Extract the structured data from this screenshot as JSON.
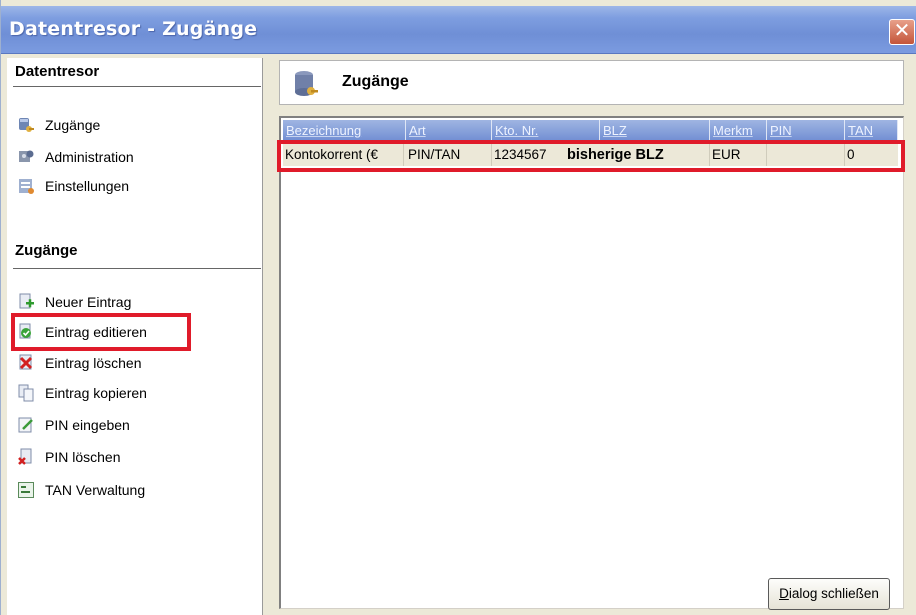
{
  "window": {
    "title": "Datentresor - Zugänge",
    "close_symbol": "✕"
  },
  "sidebar": {
    "section1_title": "Datentresor",
    "section1_items": [
      {
        "label": "Zugänge",
        "icon": "database-key-icon"
      },
      {
        "label": "Administration",
        "icon": "gear-puzzle-icon"
      },
      {
        "label": "Einstellungen",
        "icon": "settings-list-icon"
      }
    ],
    "section2_title": "Zugänge",
    "section2_items": [
      {
        "label": "Neuer Eintrag",
        "icon": "new-entry-icon"
      },
      {
        "label": "Eintrag editieren",
        "icon": "edit-entry-icon"
      },
      {
        "label": "Eintrag löschen",
        "icon": "delete-entry-icon"
      },
      {
        "label": "Eintrag kopieren",
        "icon": "copy-entry-icon"
      },
      {
        "label": "PIN eingeben",
        "icon": "pin-enter-icon"
      },
      {
        "label": "PIN löschen",
        "icon": "pin-delete-icon"
      },
      {
        "label": "TAN Verwaltung",
        "icon": "tan-management-icon"
      }
    ]
  },
  "main": {
    "header_title": "Zugänge",
    "columns": [
      "Bezeichnung",
      "Art",
      "Kto. Nr.",
      "BLZ",
      "Merkm",
      "PIN",
      "TAN"
    ],
    "rows": [
      [
        "Kontokorrent (€",
        "PIN/TAN",
        "1234567",
        "bisherige BLZ",
        "EUR",
        "",
        "0"
      ]
    ],
    "close_button": {
      "accel": "D",
      "rest": "ialog schließen"
    }
  },
  "colors": {
    "highlight": "#e01b2a",
    "titlebar": "#7e9ee0",
    "column_header": "#8aa3da"
  }
}
